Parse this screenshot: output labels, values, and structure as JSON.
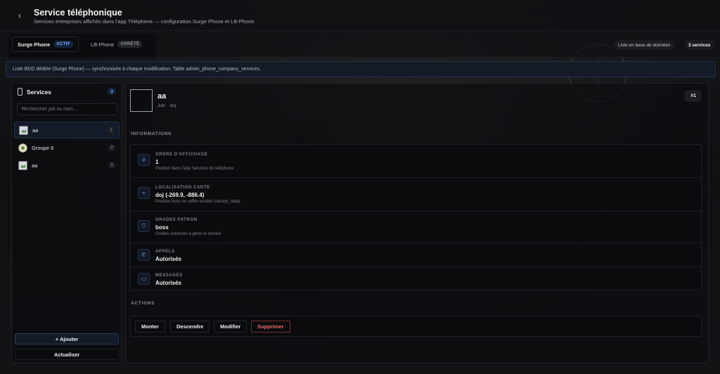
{
  "header": {
    "title": "Service téléphonique",
    "subtitle": "Services entreprises affichés dans l'app Téléphone — configuration Surge Phone et LB-Phone"
  },
  "providers": [
    {
      "label": "Surge Phone",
      "status": "ACTIF"
    },
    {
      "label": "LB-Phone",
      "status": "ARRÊTÉ"
    }
  ],
  "chips": {
    "database": "Liste en base de données",
    "count": "3 services"
  },
  "banner": "Liste BDD dédiée (Surge Phone) — synchronisée à chaque modification. Table admin_phone_company_services.",
  "sidebar": {
    "title": "Services",
    "count": "3",
    "search_placeholder": "Rechercher job ou nom...",
    "items": [
      {
        "label": "aa",
        "index": "1"
      },
      {
        "label": "Groupe 6",
        "index": "2"
      },
      {
        "label": "aa",
        "index": "3"
      }
    ],
    "add_label": "+ Ajouter",
    "refresh_label": "Actualiser"
  },
  "detail": {
    "name": "aa",
    "job_label": "Job",
    "job_value": "doj",
    "id": "#1",
    "info_title": "INFORMATIONS",
    "fields": [
      {
        "label": "ORDRE D'AFFICHAGE",
        "value": "1",
        "hint": "Position dans l'app Services du téléphone",
        "icon": "hash-icon"
      },
      {
        "label": "LOCALISATION CARTE",
        "value": "doj (-269.9, -886.4)",
        "hint": "Position boss ou coffre société (society_data)",
        "icon": "map-pin-icon"
      },
      {
        "label": "GRADES PATRON",
        "value": "boss",
        "hint": "Grades autorisés à gérer le service",
        "icon": "shield-icon"
      },
      {
        "label": "APPELS",
        "value": "Autorisés",
        "hint": "",
        "icon": "phone-icon"
      },
      {
        "label": "MESSAGES",
        "value": "Autorisés",
        "hint": "",
        "icon": "message-icon"
      }
    ],
    "actions_title": "ACTIONS",
    "actions": {
      "up": "Monter",
      "down": "Descendre",
      "edit": "Modifier",
      "delete": "Supprimer"
    }
  },
  "colors": {
    "accent": "#7fb0f0",
    "danger": "#ee6b6b",
    "background": "#0b0c0f"
  }
}
